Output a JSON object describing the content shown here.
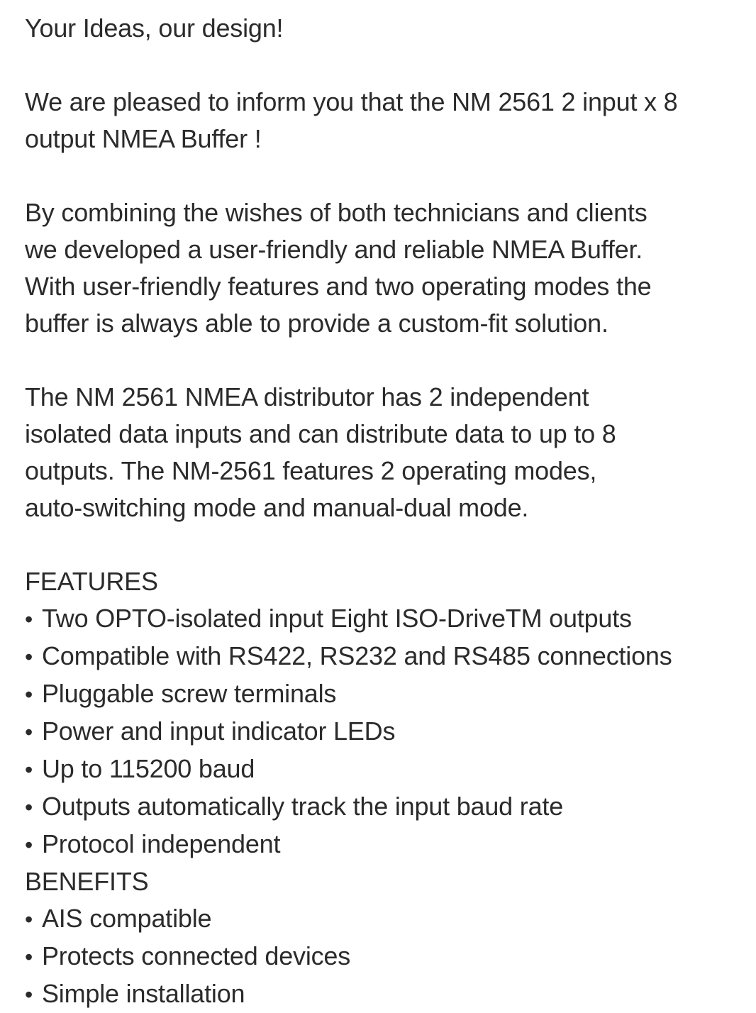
{
  "intro": {
    "tagline": "Your Ideas, our design!",
    "announcement": "We are pleased to inform you that the NM 2561 2 input x 8\noutput NMEA Buffer !",
    "description_1": "By combining the wishes of both technicians and clients\nwe developed a user-friendly and reliable NMEA Buffer.\nWith user-friendly features and two operating modes the\nbuffer is always able to provide a custom-fit solution.",
    "description_2": "The NM 2561 NMEA distributor has 2 independent\nisolated data inputs and can distribute data to up to 8\noutputs. The NM-2561 features 2 operating modes,\nauto-switching mode and manual-dual mode."
  },
  "features": {
    "heading": "FEATURES",
    "items": [
      "Two OPTO-isolated input Eight ISO-DriveTM outputs",
      "Compatible with RS422, RS232 and RS485 connections",
      "Pluggable screw terminals",
      "Power and input indicator LEDs",
      "Up to 115200 baud",
      "Outputs automatically track the input baud rate",
      "Protocol independent"
    ]
  },
  "benefits": {
    "heading": "BENEFITS",
    "items": [
      "AIS compatible",
      "Protects connected devices",
      "Simple installation"
    ]
  },
  "bullet_glyph": "•"
}
